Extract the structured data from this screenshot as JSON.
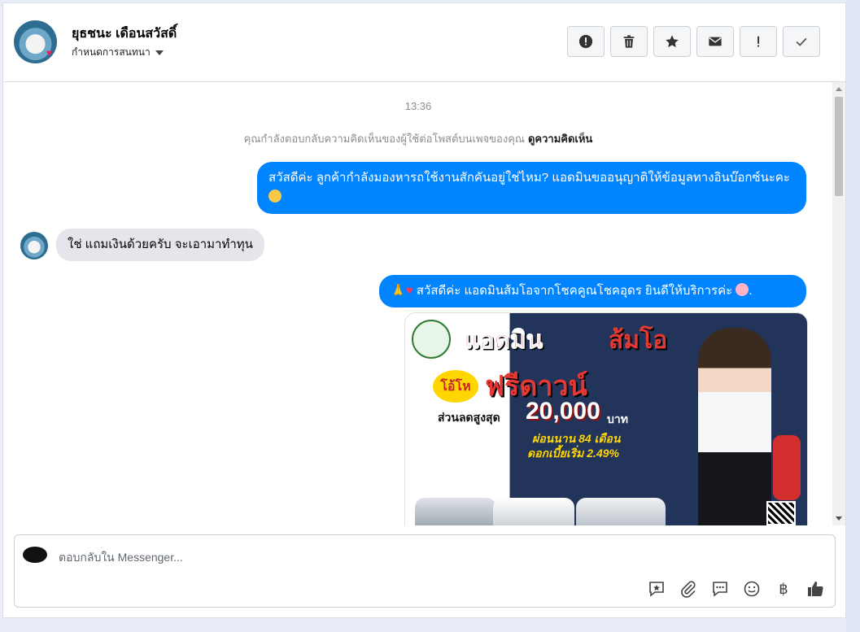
{
  "header": {
    "contact_name": "ยุธชนะ เดือนสวัสดิ์",
    "assign_label": "กำหนดการสนทนา",
    "toolbar": [
      {
        "name": "report-icon",
        "label": "Report"
      },
      {
        "name": "trash-icon",
        "label": "Delete"
      },
      {
        "name": "star-icon",
        "label": "Star"
      },
      {
        "name": "mail-icon",
        "label": "Mark unread"
      },
      {
        "name": "exclamation-icon",
        "label": "Follow up"
      },
      {
        "name": "check-icon",
        "label": "Done"
      }
    ]
  },
  "chat": {
    "timestamp": "13:36",
    "notice_text": "คุณกำลังตอบกลับความคิดเห็นของผู้ใช้ต่อโพสต์บนเพจของคุณ",
    "notice_link": "ดูความคิดเห็น",
    "messages": [
      {
        "direction": "out",
        "text": "สวัสดีค่ะ ลูกค้ากำลังมองหารถใช้งานสักคันอยู่ใช่ไหม? แอดมินขออนุญาติให้ข้อมูลทางอินบ๊อกซ์นะคะ"
      },
      {
        "direction": "in",
        "text": "ใช่ แถมเงินด้วยครับ จะเอามาทำทุน"
      },
      {
        "direction": "out",
        "text": "สวัสดีค่ะ แอดมินส้มโอจากโชคคูณโชคอุดร ยินดีให้บริการค่ะ"
      }
    ],
    "promo_image": {
      "line1a": "แอดมิน",
      "line1b": "ส้มโอ",
      "burst": "โอ้โห",
      "line2": "ฟรีดาวน์",
      "discount_label": "ส่วนลดสูงสุด",
      "discount_value": "20,000",
      "discount_unit": "บาท",
      "installment": "ผ่อนนาน 84 เดือน",
      "interest": "ดอกเบี้ยเริ่ม 2.49%"
    }
  },
  "composer": {
    "placeholder": "ตอบกลับใน Messenger...",
    "tools": [
      "saved-reply-icon",
      "attach-icon",
      "chat-bubble-icon",
      "emoji-icon",
      "baht-icon",
      "thumbs-up-icon"
    ],
    "baht_symbol": "฿"
  },
  "colors": {
    "outgoing_bubble": "#0084ff",
    "incoming_bubble": "#e4e6eb",
    "page_background": "#e9edf7"
  }
}
